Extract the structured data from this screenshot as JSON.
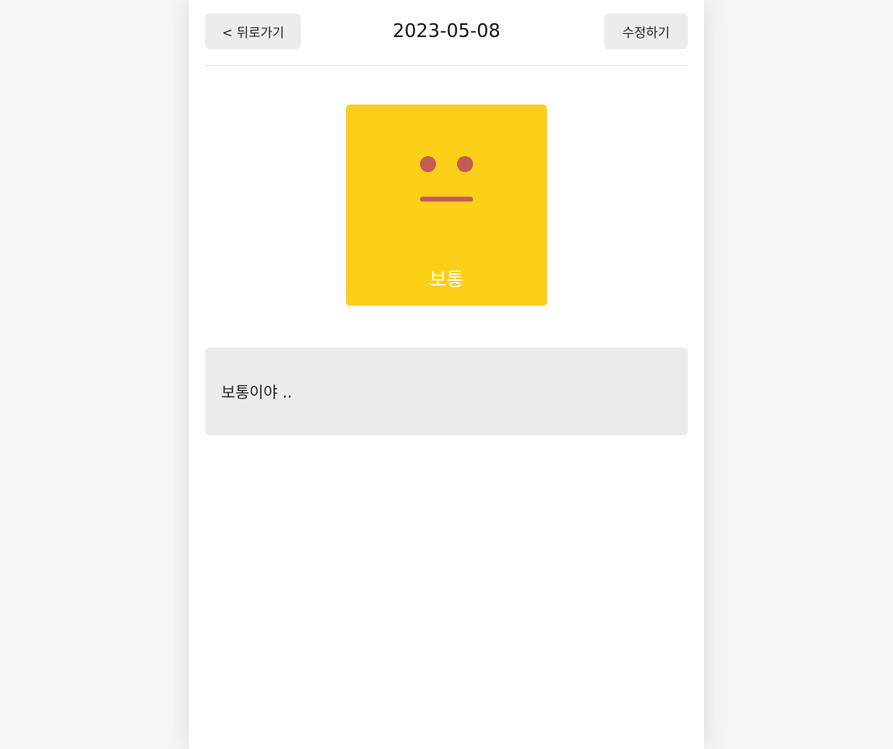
{
  "header": {
    "back_label": "< 뒤로가기",
    "date": "2023-05-08",
    "edit_label": "수정하기"
  },
  "emotion": {
    "label": "보통",
    "face": "neutral-face-icon",
    "bg_color": "#fccf18",
    "face_color": "#c35b57"
  },
  "diary": {
    "content": "보통이야 .."
  }
}
